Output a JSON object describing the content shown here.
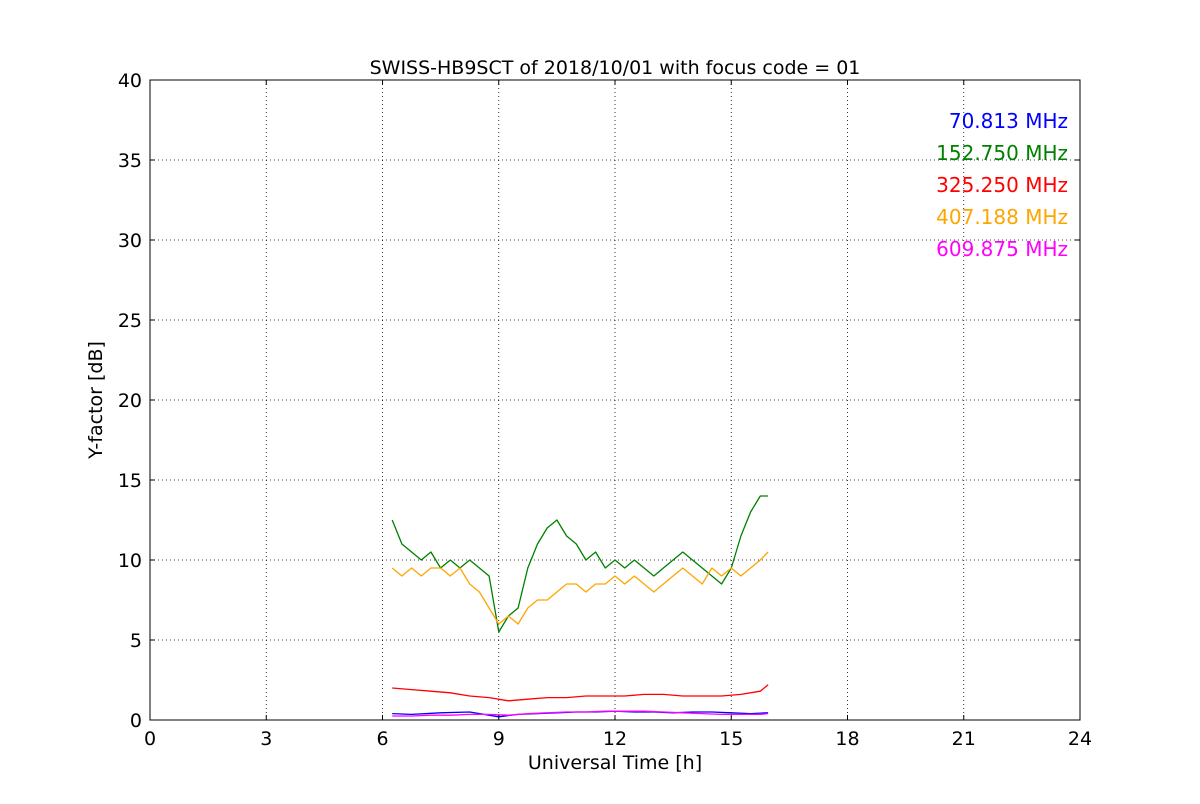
{
  "chart_data": {
    "type": "line",
    "title": "SWISS-HB9SCT of 2018/10/01 with focus code = 01",
    "xlabel": "Universal Time [h]",
    "ylabel": "Y-factor [dB]",
    "xlim": [
      0,
      24
    ],
    "ylim": [
      0,
      40
    ],
    "xticks": [
      0,
      3,
      6,
      9,
      12,
      15,
      18,
      21,
      24
    ],
    "yticks": [
      0,
      5,
      10,
      15,
      20,
      25,
      30,
      35,
      40
    ],
    "grid": true,
    "legend_position": "top-right",
    "series": [
      {
        "name": "70.813 MHz",
        "color": "#0000ff",
        "x": [
          6.25,
          6.75,
          7.5,
          8.25,
          9.0,
          9.5,
          10.0,
          10.5,
          11.0,
          11.5,
          12.0,
          12.5,
          13.0,
          13.5,
          14.0,
          14.5,
          15.0,
          15.5,
          15.95
        ],
        "y": [
          0.4,
          0.35,
          0.45,
          0.5,
          0.2,
          0.35,
          0.4,
          0.45,
          0.5,
          0.5,
          0.55,
          0.5,
          0.5,
          0.45,
          0.5,
          0.5,
          0.45,
          0.4,
          0.45
        ]
      },
      {
        "name": "152.750 MHz",
        "color": "#008000",
        "x": [
          6.25,
          6.5,
          6.75,
          7.0,
          7.25,
          7.5,
          7.75,
          8.0,
          8.25,
          8.5,
          8.75,
          9.0,
          9.25,
          9.5,
          9.75,
          10.0,
          10.25,
          10.5,
          10.75,
          11.0,
          11.25,
          11.5,
          11.75,
          12.0,
          12.25,
          12.5,
          12.75,
          13.0,
          13.25,
          13.5,
          13.75,
          14.0,
          14.25,
          14.5,
          14.75,
          15.0,
          15.25,
          15.5,
          15.75,
          15.95
        ],
        "y": [
          12.5,
          11.0,
          10.5,
          10.0,
          10.5,
          9.5,
          10.0,
          9.5,
          10.0,
          9.5,
          9.0,
          5.5,
          6.5,
          7.0,
          9.5,
          11.0,
          12.0,
          12.5,
          11.5,
          11.0,
          10.0,
          10.5,
          9.5,
          10.0,
          9.5,
          10.0,
          9.5,
          9.0,
          9.5,
          10.0,
          10.5,
          10.0,
          9.5,
          9.0,
          8.5,
          9.5,
          11.5,
          13.0,
          14.0,
          14.0
        ]
      },
      {
        "name": "325.250 MHz",
        "color": "#ff0000",
        "x": [
          6.25,
          6.75,
          7.25,
          7.75,
          8.25,
          8.75,
          9.25,
          9.75,
          10.25,
          10.75,
          11.25,
          11.75,
          12.25,
          12.75,
          13.25,
          13.75,
          14.25,
          14.75,
          15.25,
          15.75,
          15.95
        ],
        "y": [
          2.0,
          1.9,
          1.8,
          1.7,
          1.5,
          1.4,
          1.2,
          1.3,
          1.4,
          1.4,
          1.5,
          1.5,
          1.5,
          1.6,
          1.6,
          1.5,
          1.5,
          1.5,
          1.6,
          1.8,
          2.2
        ]
      },
      {
        "name": "407.188 MHz",
        "color": "#ffa500",
        "x": [
          6.25,
          6.5,
          6.75,
          7.0,
          7.25,
          7.5,
          7.75,
          8.0,
          8.25,
          8.5,
          8.75,
          9.0,
          9.25,
          9.5,
          9.75,
          10.0,
          10.25,
          10.5,
          10.75,
          11.0,
          11.25,
          11.5,
          11.75,
          12.0,
          12.25,
          12.5,
          12.75,
          13.0,
          13.25,
          13.5,
          13.75,
          14.0,
          14.25,
          14.5,
          14.75,
          15.0,
          15.25,
          15.5,
          15.75,
          15.95
        ],
        "y": [
          9.5,
          9.0,
          9.5,
          9.0,
          9.5,
          9.5,
          9.0,
          9.5,
          8.5,
          8.0,
          7.0,
          6.0,
          6.5,
          6.0,
          7.0,
          7.5,
          7.5,
          8.0,
          8.5,
          8.5,
          8.0,
          8.5,
          8.5,
          9.0,
          8.5,
          9.0,
          8.5,
          8.0,
          8.5,
          9.0,
          9.5,
          9.0,
          8.5,
          9.5,
          9.0,
          9.5,
          9.0,
          9.5,
          10.0,
          10.5
        ]
      },
      {
        "name": "609.875 MHz",
        "color": "#ff00ff",
        "x": [
          6.25,
          6.75,
          7.25,
          7.75,
          8.25,
          8.75,
          9.25,
          9.75,
          10.25,
          10.75,
          11.25,
          11.75,
          12.25,
          12.75,
          13.25,
          13.75,
          14.25,
          14.75,
          15.25,
          15.75,
          15.95
        ],
        "y": [
          0.25,
          0.25,
          0.3,
          0.3,
          0.35,
          0.35,
          0.3,
          0.4,
          0.45,
          0.5,
          0.5,
          0.55,
          0.55,
          0.55,
          0.5,
          0.45,
          0.4,
          0.35,
          0.35,
          0.35,
          0.4
        ]
      }
    ]
  }
}
